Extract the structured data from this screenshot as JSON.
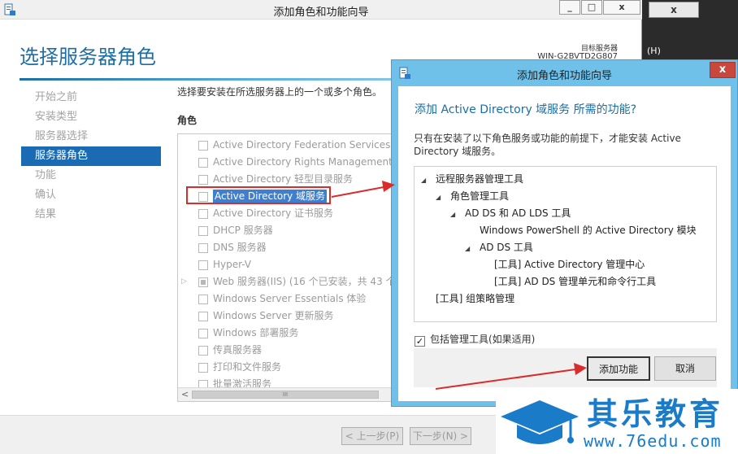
{
  "background": {
    "close_label": "x",
    "menu_hint": "(H)"
  },
  "main": {
    "title": "添加角色和功能向导",
    "win_buttons": [
      "_",
      "□",
      "x"
    ],
    "page_title": "选择服务器角色",
    "target_label": "目标服务器",
    "target_value": "WIN-G2BVTD2G807",
    "steps": [
      {
        "label": "开始之前",
        "active": false
      },
      {
        "label": "安装类型",
        "active": false
      },
      {
        "label": "服务器选择",
        "active": false
      },
      {
        "label": "服务器角色",
        "active": true
      },
      {
        "label": "功能",
        "active": false
      },
      {
        "label": "确认",
        "active": false
      },
      {
        "label": "结果",
        "active": false
      }
    ],
    "instruction": "选择要安装在所选服务器上的一个或多个角色。",
    "roles_header": "角色",
    "roles": [
      "Active Directory Federation Services",
      "Active Directory Rights Management S",
      "Active Directory 轻型目录服务",
      "Active Directory 域服务",
      "Active Directory 证书服务",
      "DHCP 服务器",
      "DNS 服务器",
      "Hyper-V",
      "Web 服务器(IIS) (16 个已安装，共 43 个",
      "Windows Server Essentials 体验",
      "Windows Server 更新服务",
      "Windows 部署服务",
      "传真服务器",
      "打印和文件服务",
      "批量激活服务"
    ],
    "scroll_thumb": "III",
    "prev_button": "< 上一步(P)",
    "next_button": "下一步(N) >"
  },
  "dialog": {
    "title": "添加角色和功能向导",
    "close": "x",
    "heading": "添加 Active Directory 域服务 所需的功能?",
    "description": "只有在安装了以下角色服务或功能的前提下，才能安装 Active Directory 域服务。",
    "tree": [
      "远程服务器管理工具",
      "角色管理工具",
      "AD DS 和 AD LDS 工具",
      "Windows PowerShell 的 Active Directory 模块",
      "AD DS 工具",
      "[工具] Active Directory 管理中心",
      "[工具] AD DS 管理单元和命令行工具",
      "[工具] 组策略管理"
    ],
    "include_tools": "包括管理工具(如果适用)",
    "add_button": "添加功能",
    "cancel_button": "取消"
  },
  "watermark": {
    "brand": "其乐教育",
    "url": "www.76edu.com"
  },
  "colors": {
    "accent": "#1a6ab4",
    "dialog_frame": "#6fc1ea",
    "close_red": "#c9483e",
    "annotation_red": "#d92c2c"
  }
}
